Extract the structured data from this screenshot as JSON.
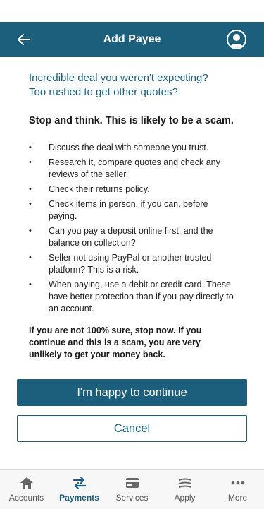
{
  "header": {
    "title": "Add Payee"
  },
  "content": {
    "headline_line1": "Incredible deal you weren't expecting?",
    "headline_line2": "Too rushed to get other quotes?",
    "warning": "Stop and think. This is likely to be a scam.",
    "tips": [
      "Discuss the deal with someone you trust.",
      "Research it, compare quotes and check any reviews of the seller.",
      "Check their returns policy.",
      "Check items in person, if you can, before paying.",
      "Can you pay a deposit online first, and the balance on collection?",
      "Seller not using PayPal or another trusted platform? This is a risk.",
      "When paying, use a debit or credit card. These have better protection than if you pay directly to an account."
    ],
    "stop_note": "If you are not 100% sure, stop now. If you continue and this is a scam, you are very unlikely to get your money back."
  },
  "actions": {
    "continue_label": "I'm happy to continue",
    "cancel_label": "Cancel"
  },
  "tabbar": {
    "tabs": [
      {
        "label": "Accounts",
        "icon": "home-icon"
      },
      {
        "label": "Payments",
        "icon": "transfer-arrows-icon",
        "active": true
      },
      {
        "label": "Services",
        "icon": "card-icon"
      },
      {
        "label": "Apply",
        "icon": "layers-icon"
      },
      {
        "label": "More",
        "icon": "more-dots-icon"
      }
    ]
  },
  "colors": {
    "brand": "#1b5f7d",
    "background": "#ffffff",
    "tabbar_background": "#f7f7f7"
  }
}
